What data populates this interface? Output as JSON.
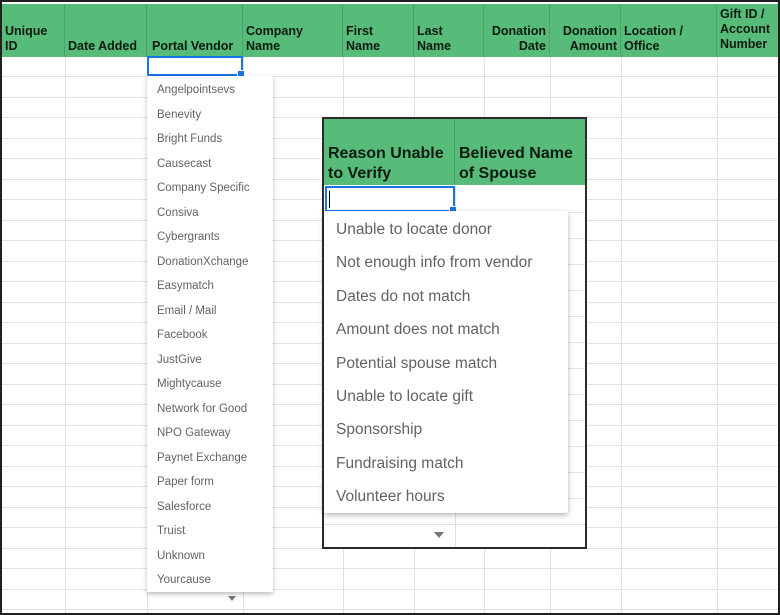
{
  "sheet": {
    "columns": [
      {
        "label": "Unique ID"
      },
      {
        "label": "Date Added"
      },
      {
        "label": "Portal Vendor"
      },
      {
        "label": "Company Name"
      },
      {
        "label": "First Name"
      },
      {
        "label": "Last Name"
      },
      {
        "label": "Donation\nDate"
      },
      {
        "label": "Donation\nAmount"
      },
      {
        "label": "Location /\nOffice"
      },
      {
        "label": "Gift ID /\nAccount\nNumber"
      }
    ],
    "colors": {
      "header_bg": "#57bb7a",
      "selection": "#1a73e8"
    }
  },
  "vendor_dropdown": {
    "options": [
      "Angelpointsevs",
      "Benevity",
      "Bright Funds",
      "Causecast",
      "Company Specific",
      "Consiva",
      "Cybergrants",
      "DonationXchange",
      "Easymatch",
      "Email / Mail",
      "Facebook",
      "JustGive",
      "Mightycause",
      "Network for Good",
      "NPO Gateway",
      "Paynet Exchange",
      "Paper form",
      "Salesforce",
      "Truist",
      "Unknown",
      "Yourcause"
    ]
  },
  "inset": {
    "columns": [
      {
        "label": "Reason Unable\nto Verify"
      },
      {
        "label": "Believed Name\nof Spouse"
      }
    ],
    "reason_dropdown": {
      "options": [
        "Unable to locate donor",
        "Not enough info from vendor",
        "Dates do not match",
        "Amount does not match",
        "Potential spouse match",
        "Unable to locate gift",
        "Sponsorship",
        "Fundraising match",
        "Volunteer hours"
      ]
    }
  }
}
